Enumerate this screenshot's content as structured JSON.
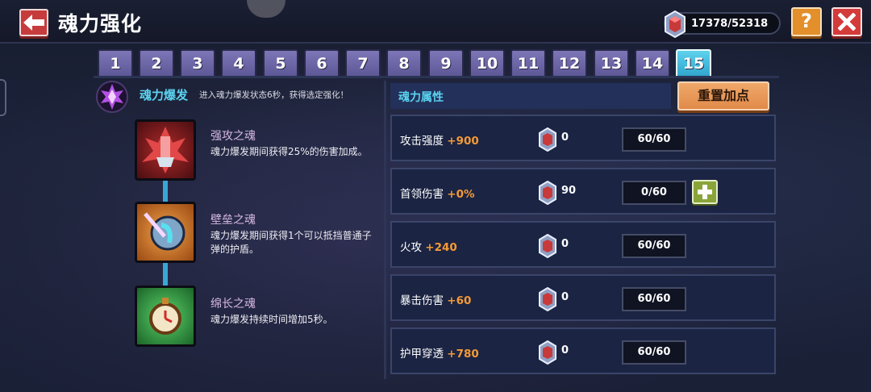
{
  "header": {
    "title": "魂力强化",
    "currency": "17378/52318"
  },
  "tabs": [
    "1",
    "2",
    "3",
    "4",
    "5",
    "6",
    "7",
    "8",
    "9",
    "10",
    "11",
    "12",
    "13",
    "14",
    "15"
  ],
  "active_tab": "15",
  "burst": {
    "title": "魂力爆发",
    "desc": "进入魂力爆发状态6秒，获得选定强化！"
  },
  "skills": [
    {
      "name": "强攻之魂",
      "desc": "魂力爆发期间获得25%的伤害加成。"
    },
    {
      "name": "壁垒之魂",
      "desc": "魂力爆发期间获得1个可以抵挡普通子弹的护盾。"
    },
    {
      "name": "绵长之魂",
      "desc": "魂力爆发持续时间增加5秒。"
    }
  ],
  "attributes_panel": {
    "title": "魂力属性",
    "reset_label": "重置加点"
  },
  "attributes": [
    {
      "name": "攻击强度",
      "bonus": "+900",
      "count": "0",
      "level": "60/60"
    },
    {
      "name": "首领伤害",
      "bonus": "+0%",
      "count": "90",
      "level": "0/60"
    },
    {
      "name": "火攻",
      "bonus": "+240",
      "count": "0",
      "level": "60/60"
    },
    {
      "name": "暴击伤害",
      "bonus": "+60",
      "count": "0",
      "level": "60/60"
    },
    {
      "name": "护甲穿透",
      "bonus": "+780",
      "count": "0",
      "level": "60/60"
    }
  ],
  "colors": {
    "tab_active": "#3fbde2",
    "tab_inactive": "#6e69a8",
    "accent_cyan": "#5ad3f0",
    "bonus_orange": "#f39a36",
    "reset_button": "#e8965a",
    "close_button": "#d43b3b",
    "help_button": "#e38f2c",
    "plus_button": "#8aa43a"
  },
  "icons": {
    "back": "arrow-left-icon",
    "help": "question-icon",
    "close": "close-icon",
    "currency": "soul-crystal-icon",
    "burst": "soul-burst-icon",
    "skills": [
      "fire-spirit-icon",
      "shield-spirit-icon",
      "clock-spirit-icon"
    ],
    "gem": "soul-gem-icon",
    "plus": "plus-icon"
  }
}
